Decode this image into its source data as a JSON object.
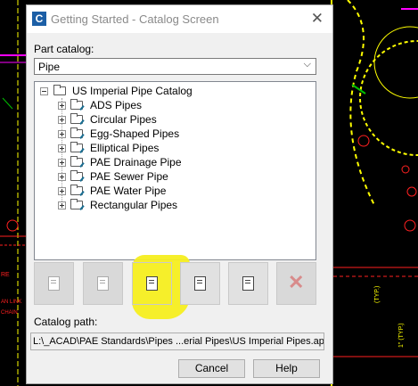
{
  "window": {
    "title": "Getting Started - Catalog Screen",
    "close_glyph": "✕",
    "app_icon_letter": "C"
  },
  "part_catalog": {
    "label": "Part catalog:",
    "selected": "Pipe",
    "arrow": "⌵"
  },
  "tree": {
    "root": "US Imperial Pipe Catalog",
    "items": [
      "ADS Pipes",
      "Circular Pipes",
      "Egg-Shaped Pipes",
      "Elliptical Pipes",
      "PAE Drainage Pipe",
      "PAE Sewer Pipe",
      "PAE Water Pipe",
      "Rectangular Pipes"
    ]
  },
  "toolbar": {
    "buttons": [
      {
        "icon": "new-part-icon",
        "enabled": false
      },
      {
        "icon": "edit-part-icon",
        "enabled": false
      },
      {
        "icon": "regenerate-icon",
        "enabled": true
      },
      {
        "icon": "validate-icon",
        "enabled": true
      },
      {
        "icon": "add-catalog-icon",
        "enabled": true
      },
      {
        "icon": "delete-icon",
        "enabled": false
      }
    ],
    "delete_glyph": "✕"
  },
  "catalog_path": {
    "label": "Catalog path:",
    "value": "L:\\_ACAD\\PAE Standards\\Pipes ...erial Pipes\\US Imperial Pipes.apc"
  },
  "buttons": {
    "cancel": "Cancel",
    "help": "Help"
  },
  "colors": {
    "highlight": "#f5ee1f",
    "cad_yellow": "#ffff00",
    "cad_red": "#ff2020",
    "cad_magenta": "#ff00ff",
    "cad_green": "#00c000"
  }
}
